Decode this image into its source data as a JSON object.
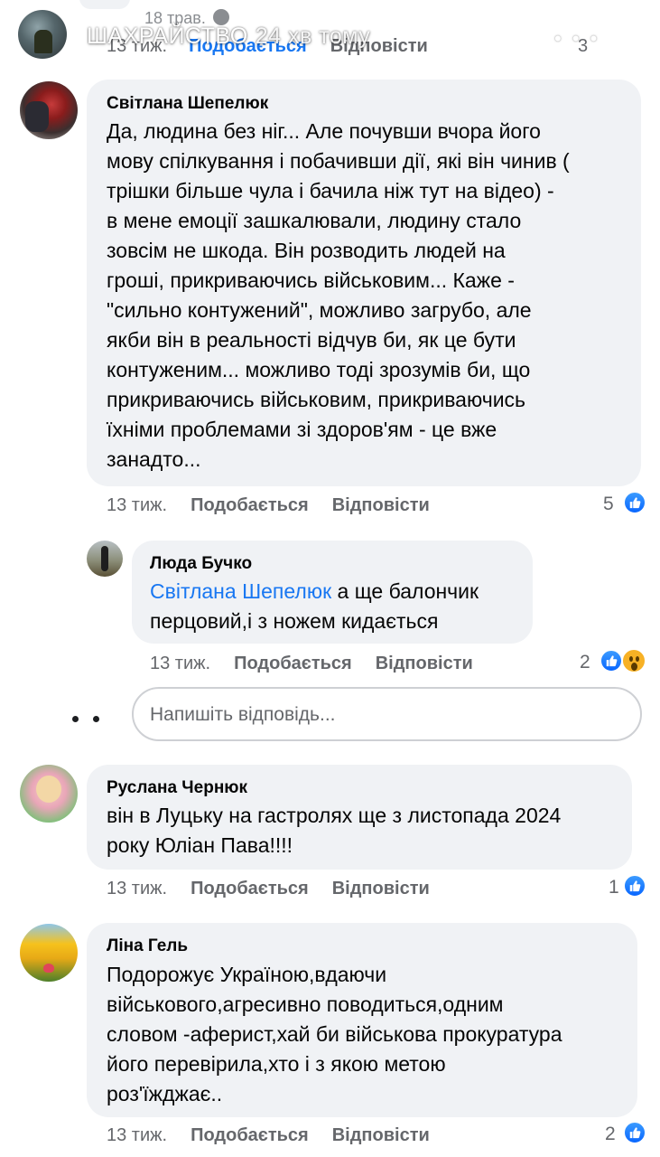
{
  "story": {
    "name": "ШАХРАЙСТВО",
    "time": "24 хв тому",
    "more_icon": "more-dots-icon",
    "close_icon": "close-icon"
  },
  "prev_comment": {
    "date": "18 трав.",
    "time_ago": "13 тиж.",
    "like_label": "Подобається",
    "reply_label": "Відповісти",
    "reaction_count": "3"
  },
  "comments": [
    {
      "author": "Світлана Шепелюк",
      "text": "Да, людина без ніг... Але почувши вчора його\nмову спілкування і побачивши дії, які він чинив (\nтрішки більше чула і бачила ніж тут на відео) -\nв мене емоції зашкалювали, людину стало\nзовсім не шкода. Він розводить людей на\nгроші, прикриваючись військовим... Каже -\n\"сильно контужений\", можливо загрубо, але\nякби він в реальності відчув би, як це бути\nконтуженим... можливо тоді зрозумів би, що\nприкриваючись військовим, прикриваючись\nїхніми проблемами зі здоров'ям - це вже\nзанадто...",
      "time_ago": "13 тиж.",
      "like_label": "Подобається",
      "reply_label": "Відповісти",
      "reaction_count": "5"
    },
    {
      "author": "Люда Бучко",
      "mention": "Світлана Шепелюк",
      "text_after_mention": " а ще балончик",
      "text_line2": "перцовий,і з ножем кидається",
      "time_ago": "13 тиж.",
      "like_label": "Подобається",
      "reply_label": "Відповісти",
      "reaction_count": "2"
    },
    {
      "author": "Руслана Чернюк",
      "text": "він в Луцьку на гастролях ще з листопада 2024\nроку Юліан Пава!!!!",
      "time_ago": "13 тиж.",
      "like_label": "Подобається",
      "reply_label": "Відповісти",
      "reaction_count": "1"
    },
    {
      "author": "Ліна Гель",
      "text": "Подорожує Україною,вдаючи\nвійськового,агресивно поводиться,одним\nсловом -аферист,хай би військова прокуратура\nйого перевірила,хто і з якою метою\nроз'їжджає..",
      "time_ago": "13 тиж.",
      "like_label": "Подобається",
      "reply_label": "Відповісти",
      "reaction_count": "2"
    }
  ],
  "reply_box": {
    "placeholder": "Напишіть відповідь..."
  },
  "colors": {
    "accent": "#1877f2",
    "bubble": "#f0f2f5",
    "meta_text": "#65676b"
  }
}
